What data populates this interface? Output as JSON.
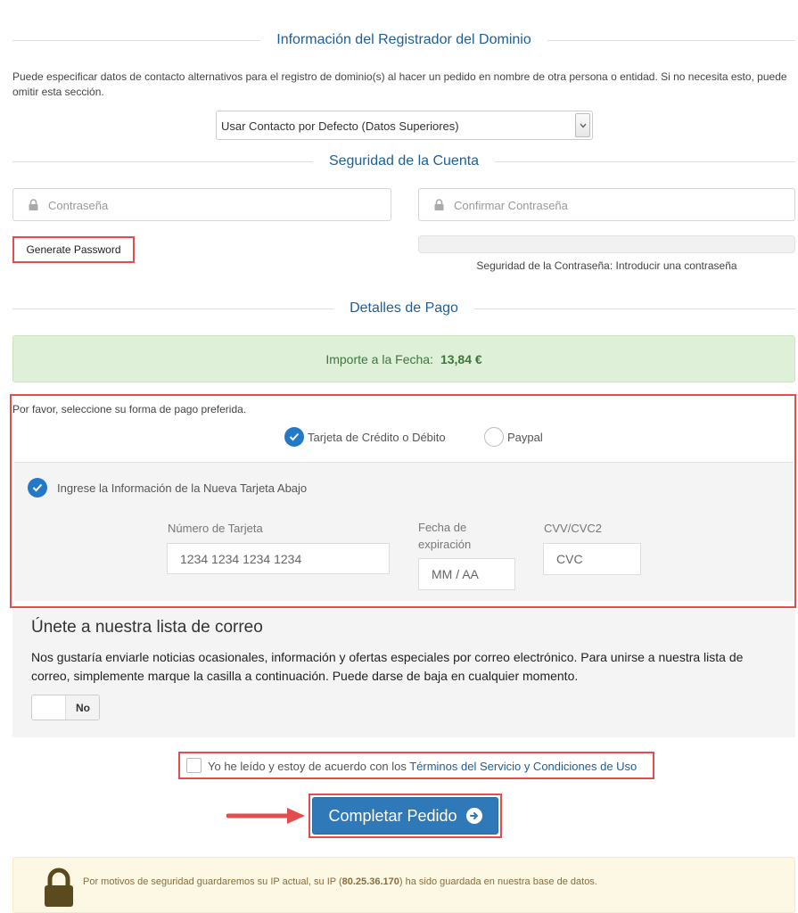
{
  "registrar": {
    "heading": "Información del Registrador del Dominio",
    "intro": "Puede especificar datos de contacto alternativos para el registro de dominio(s) al hacer un pedido en nombre de otra persona o entidad. Si no necesita esto, puede omitir esta sección.",
    "contact_select": "Usar Contacto por Defecto (Datos Superiores)"
  },
  "security": {
    "heading": "Seguridad de la Cuenta",
    "password_placeholder": "Contraseña",
    "confirm_placeholder": "Confirmar Contraseña",
    "generate_label": "Generate Password",
    "strength_text": "Seguridad de la Contraseña: Introducir una contraseña"
  },
  "payment": {
    "heading": "Detalles de Pago",
    "amount_label": "Importe a la Fecha:",
    "amount_value": "13,84 €",
    "prompt": "Por favor, seleccione su forma de pago preferida.",
    "methods": [
      {
        "label": "Tarjeta de Crédito o Débito",
        "selected": true
      },
      {
        "label": "Paypal",
        "selected": false
      }
    ],
    "new_card_label": "Ingrese la Información de la Nueva Tarjeta Abajo",
    "card_number_label": "Número de Tarjeta",
    "card_number_placeholder": "1234 1234 1234 1234",
    "expiry_label_1": "Fecha de",
    "expiry_label_2": "expiración",
    "expiry_placeholder": "MM / AA",
    "cvv_label": "CVV/CVC2",
    "cvv_placeholder": "CVC"
  },
  "mailing": {
    "title": "Únete a nuestra lista de correo",
    "description": "Nos gustaría enviarle noticias ocasionales, información y ofertas especiales por correo electrónico. Para unirse a nuestra lista de correo, simplemente marque la casilla a continuación. Puede darse de baja en cualquier momento.",
    "toggle_off": "No"
  },
  "tos": {
    "prefix": "Yo he leído y estoy de acuerdo con los ",
    "link": "Términos del Servicio y Condiciones de Uso"
  },
  "complete_label": "Completar Pedido",
  "notice": {
    "prefix": "Por motivos de seguridad guardaremos su IP actual, su IP (",
    "ip": "80.25.36.170",
    "suffix": ") ha sido guardada en nuestra base de datos."
  },
  "colors": {
    "accent": "#2478c8",
    "heading": "#1d5f9a",
    "highlight": "#e44d4d",
    "success_bg": "#dff0d8",
    "warning_bg": "#fcf8e3"
  }
}
